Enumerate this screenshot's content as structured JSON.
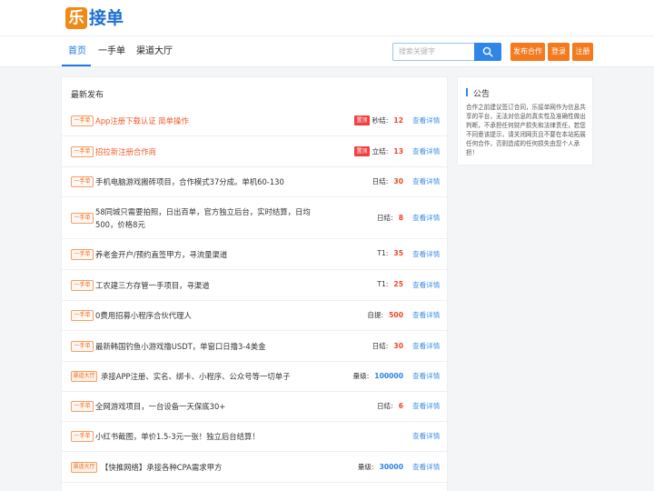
{
  "brand": {
    "logo_char": "乐",
    "name": "接单"
  },
  "nav": {
    "items": [
      {
        "label": "首页",
        "active": true
      },
      {
        "label": "一手单",
        "active": false
      },
      {
        "label": "渠道大厅",
        "active": false
      }
    ]
  },
  "search": {
    "placeholder": "搜索关键字",
    "icon": "search-icon"
  },
  "actions": {
    "publish": "发布合作",
    "login": "登录",
    "register": "注册"
  },
  "main": {
    "section_title": "最新发布",
    "detail_label": "查看详情",
    "rows": [
      {
        "tag": "一手单",
        "title": "App注册下载认证 简单操作",
        "hot": true,
        "badge": "置顶",
        "stat_label": "秒结:",
        "stat_value": "12"
      },
      {
        "tag": "一手单",
        "title": "招拉新注册合作商",
        "hot": true,
        "badge": "置顶",
        "stat_label": "立结:",
        "stat_value": "13"
      },
      {
        "tag": "一手单",
        "title": "手机电脑游戏搬砖项目，合作模式37分成。单机60-130",
        "hot": false,
        "badge": "",
        "stat_label": "日结:",
        "stat_value": "30"
      },
      {
        "tag": "一手单",
        "title": "58同城只需要拍照，日出百单，官方独立后台，实时结算，日均500，价格8元",
        "hot": false,
        "badge": "",
        "stat_label": "日结:",
        "stat_value": "8"
      },
      {
        "tag": "一手单",
        "title": "养老金开户/预约直签甲方，寻流量渠道",
        "hot": false,
        "badge": "",
        "stat_label": "T1:",
        "stat_value": "35"
      },
      {
        "tag": "一手单",
        "title": "工农建三方存管一手项目，寻渠道",
        "hot": false,
        "badge": "",
        "stat_label": "T1:",
        "stat_value": "25"
      },
      {
        "tag": "一手单",
        "title": "0费用招募小程序合伙代理人",
        "hot": false,
        "badge": "",
        "stat_label": "自提:",
        "stat_value": "500"
      },
      {
        "tag": "一手单",
        "title": "最新韩国钓鱼小游戏撸USDT，单窗口日撸3-4美金",
        "hot": false,
        "badge": "",
        "stat_label": "日结:",
        "stat_value": "30"
      },
      {
        "tag": "渠道大厅",
        "title": "承接APP注册、实名、绑卡、小程序、公众号等一切单子",
        "hot": false,
        "badge": "",
        "stat_label": "量级:",
        "stat_value": "100000"
      },
      {
        "tag": "一手单",
        "title": "全网游戏项目，一台设备一天保底30+",
        "hot": false,
        "badge": "",
        "stat_label": "日结:",
        "stat_value": "6"
      },
      {
        "tag": "一手单",
        "title": "小红书截图，单价1.5-3元一张！独立后台结算！",
        "hot": false,
        "badge": "",
        "stat_label": "",
        "stat_value": ""
      },
      {
        "tag": "渠道大厅",
        "title": "【快推网络】承接各种CPA需求甲方",
        "hot": false,
        "badge": "",
        "stat_label": "量级:",
        "stat_value": "30000"
      }
    ]
  },
  "notice": {
    "title": "公告",
    "text": "合作之前建议签订合同，乐接单网作为信息共享的平台，无法对信息的真实性及准确性做出判断，不承担任何财产损失和法律责任，若您不同意该提示，请关闭网页且不要在本站拓展任何合作，否则造成的任何损失由您个人承担！"
  },
  "colors": {
    "primary": "#1f78e8",
    "accent": "#f47a1f",
    "hot": "#f0432a"
  }
}
